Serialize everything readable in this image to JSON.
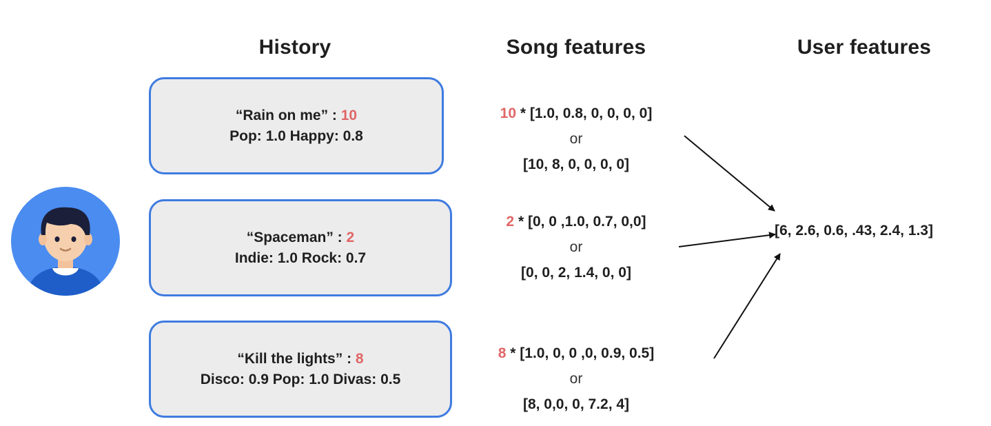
{
  "columns": {
    "history": "History",
    "song": "Song features",
    "user": "User features"
  },
  "history": [
    {
      "title": "“Rain on me”",
      "sep": " : ",
      "count": "10",
      "tags": "Pop: 1.0  Happy: 0.8"
    },
    {
      "title": "“Spaceman”",
      "sep": " : ",
      "count": "2",
      "tags": "Indie: 1.0 Rock: 0.7"
    },
    {
      "title": "“Kill the lights”",
      "sep": " :  ",
      "count": "8",
      "tags": "Disco: 0.9 Pop: 1.0 Divas: 0.5"
    }
  ],
  "song_features": [
    {
      "weight": "10",
      "vector": " * [1.0, 0.8, 0, 0, 0, 0]",
      "or": "or",
      "result": "[10, 8, 0, 0, 0, 0]"
    },
    {
      "weight": "2",
      "vector": " * [0, 0 ,1.0, 0.7, 0,0]",
      "or": "or",
      "result": "[0, 0, 2, 1.4, 0, 0]"
    },
    {
      "weight": "8",
      "vector": " * [1.0, 0, 0 ,0, 0.9, 0.5]",
      "or": "or",
      "result": "[8, 0,0, 0, 7.2, 4]"
    }
  ],
  "user_features": "[6, 2.6, 0.6, .43, 2.4, 1.3]",
  "colors": {
    "card_border": "#3f7be0",
    "card_fill": "#ececed",
    "highlight": "#e06666",
    "avatar_bg": "#4a8cf0"
  }
}
